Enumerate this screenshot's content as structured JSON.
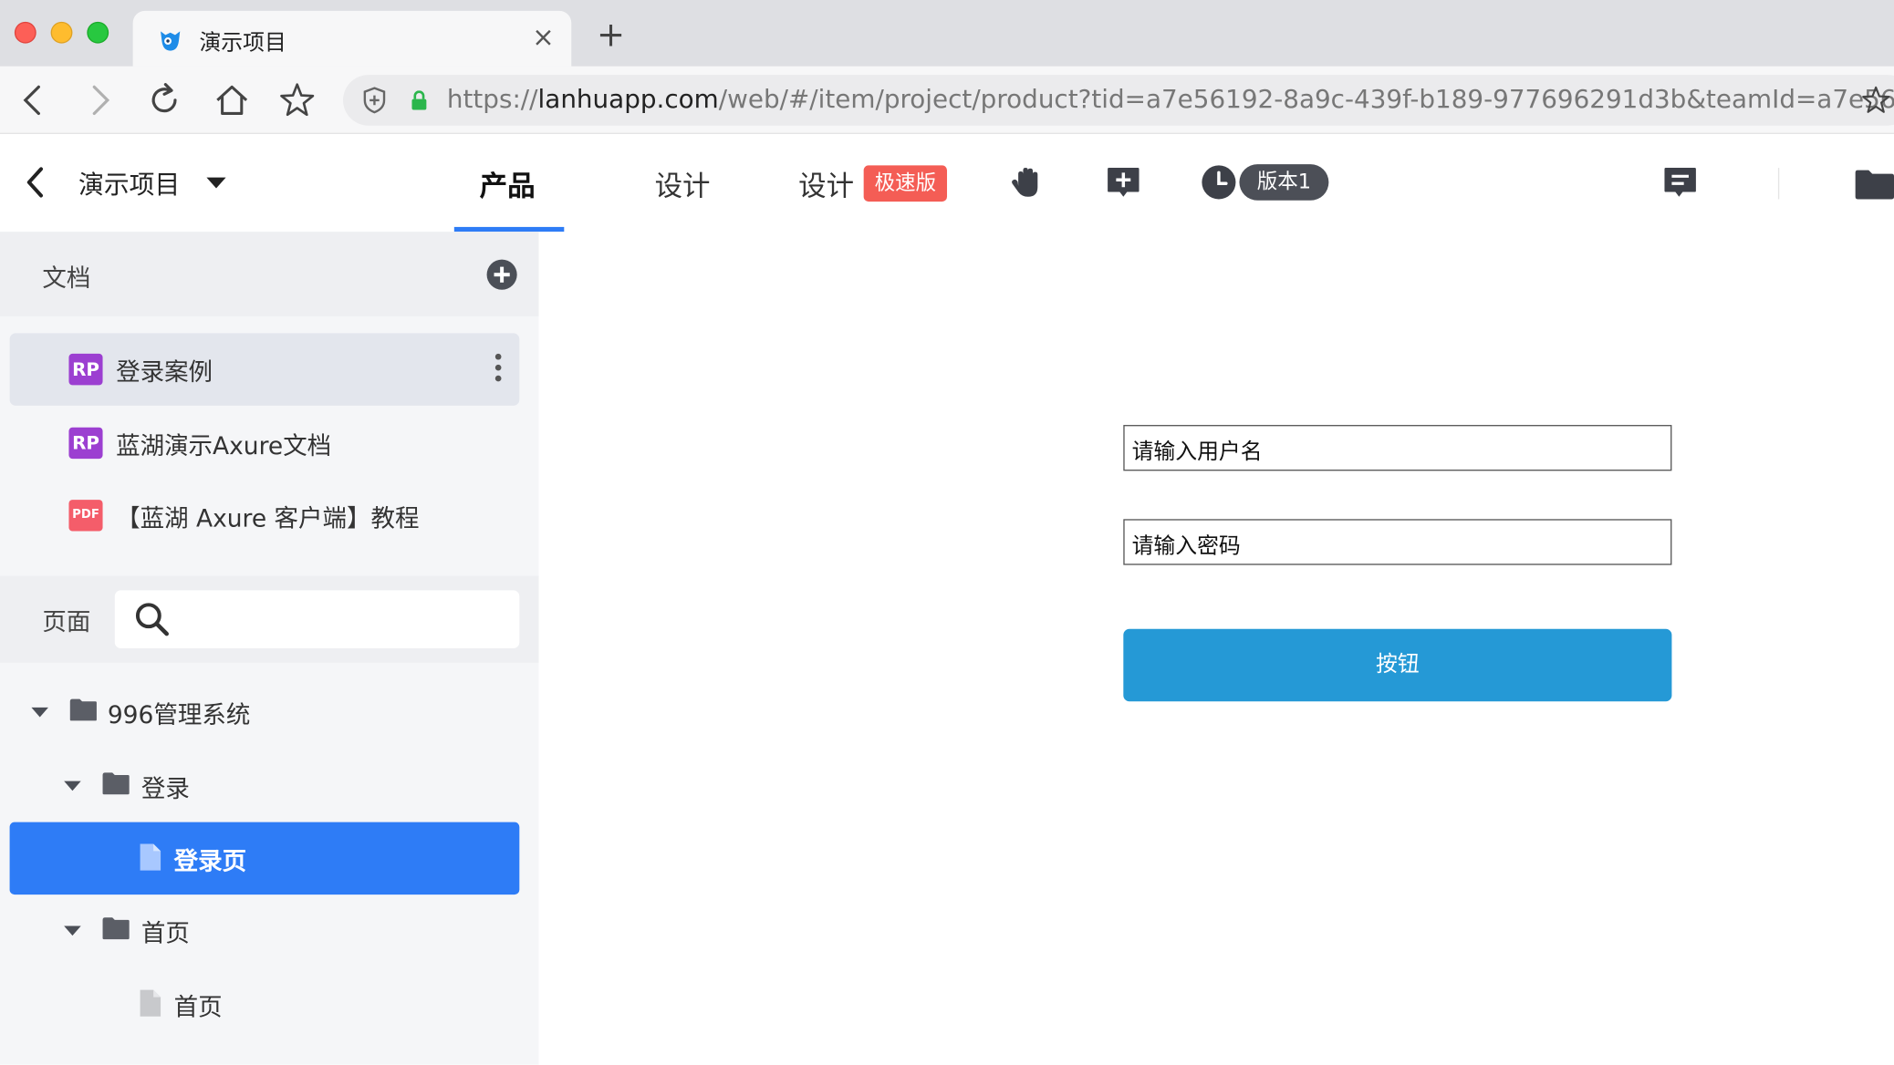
{
  "browser": {
    "tab_title": "演示项目",
    "tab_close": "×",
    "new_tab": "+",
    "url_prefix": "https://",
    "url_host": "lanhuapp.com",
    "url_path": "/web/#/item/project/product?tid=a7e56192-8a9c-439f-b189-977696291d3b&teamId=a7e56192-..."
  },
  "header": {
    "project_name": "演示项目",
    "tabs": [
      {
        "label": "产品"
      },
      {
        "label": "设计"
      },
      {
        "label": "设计"
      }
    ],
    "fast_badge": "极速版",
    "version_label": "版本1"
  },
  "sidebar": {
    "docs_title": "文档",
    "documents": [
      {
        "badge": "RP",
        "label": "登录案例"
      },
      {
        "badge": "RP",
        "label": "蓝湖演示Axure文档"
      },
      {
        "badge": "PDF",
        "label": "【蓝湖 Axure 客户端】教程"
      }
    ],
    "pages_title": "页面",
    "tree": [
      {
        "label": "996管理系统"
      },
      {
        "label": "登录"
      },
      {
        "label": "登录页"
      },
      {
        "label": "首页"
      },
      {
        "label": "首页"
      }
    ]
  },
  "prototype": {
    "username_placeholder": "请输入用户名",
    "password_placeholder": "请输入密码",
    "button_label": "按钮"
  },
  "colors": {
    "accent": "#2e7cf6",
    "prototype_button": "#2599d6",
    "rp_badge": "#9c3fd1",
    "pdf_badge": "#f45d6a",
    "fast_badge": "#f45d55"
  }
}
